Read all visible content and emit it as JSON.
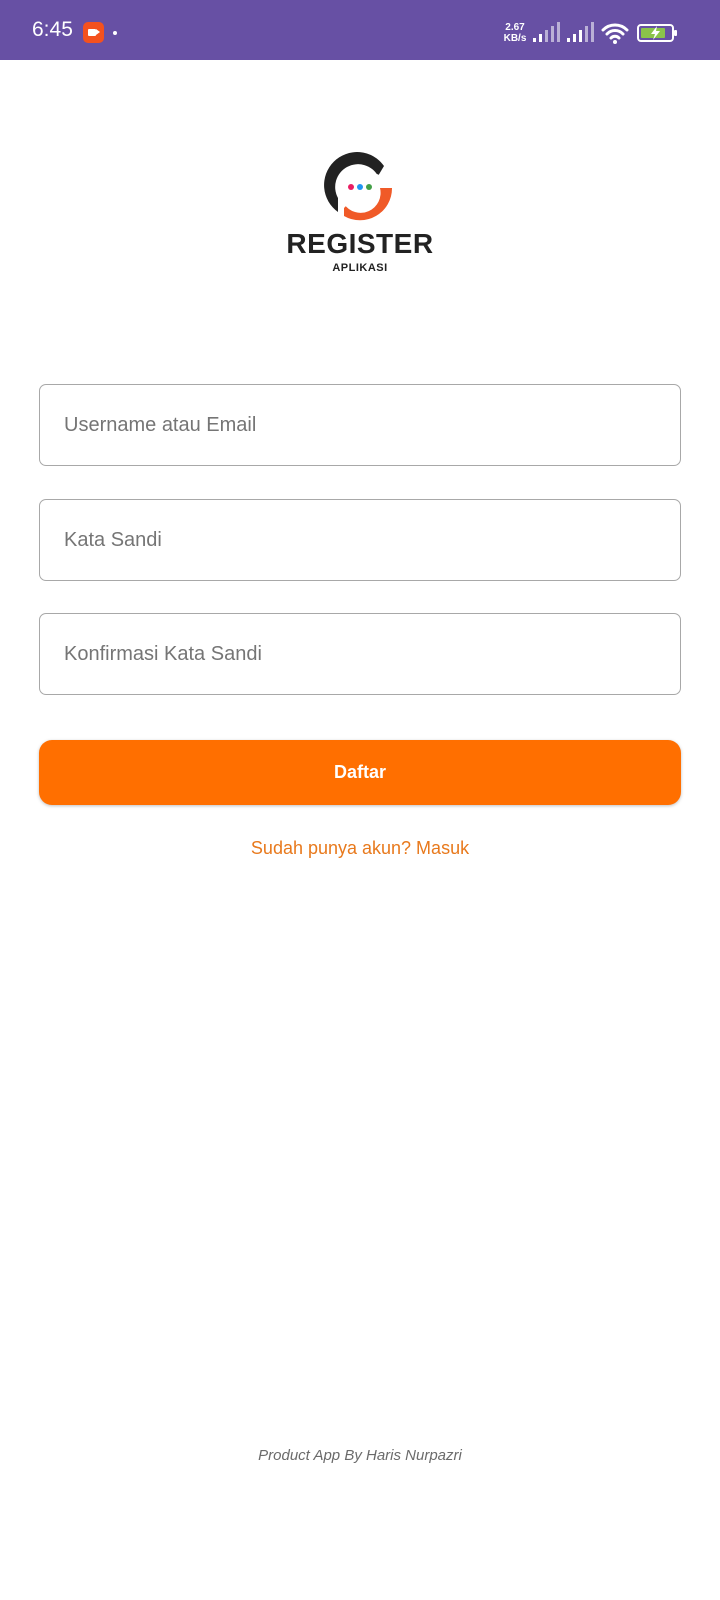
{
  "status_bar": {
    "time": "6:45",
    "network_speed_value": "2.67",
    "network_speed_unit": "KB/s",
    "icons": [
      "screen-record-icon",
      "signal-icon",
      "signal-icon",
      "wifi-icon",
      "battery-charging-icon"
    ],
    "background_color": "#6750A4"
  },
  "logo": {
    "title": "REGISTER",
    "subtitle": "APLIKASI"
  },
  "form": {
    "username_placeholder": "Username atau Email",
    "password_placeholder": "Kata Sandi",
    "confirm_password_placeholder": "Konfirmasi Kata Sandi",
    "submit_label": "Daftar",
    "login_link": "Sudah punya akun? Masuk"
  },
  "footer": {
    "credit": "Product App By Haris Nurpazri"
  },
  "colors": {
    "accent": "#FF6F00",
    "link": "#E8791C",
    "logo_dark": "#222222",
    "logo_orange": "#F05A28"
  }
}
